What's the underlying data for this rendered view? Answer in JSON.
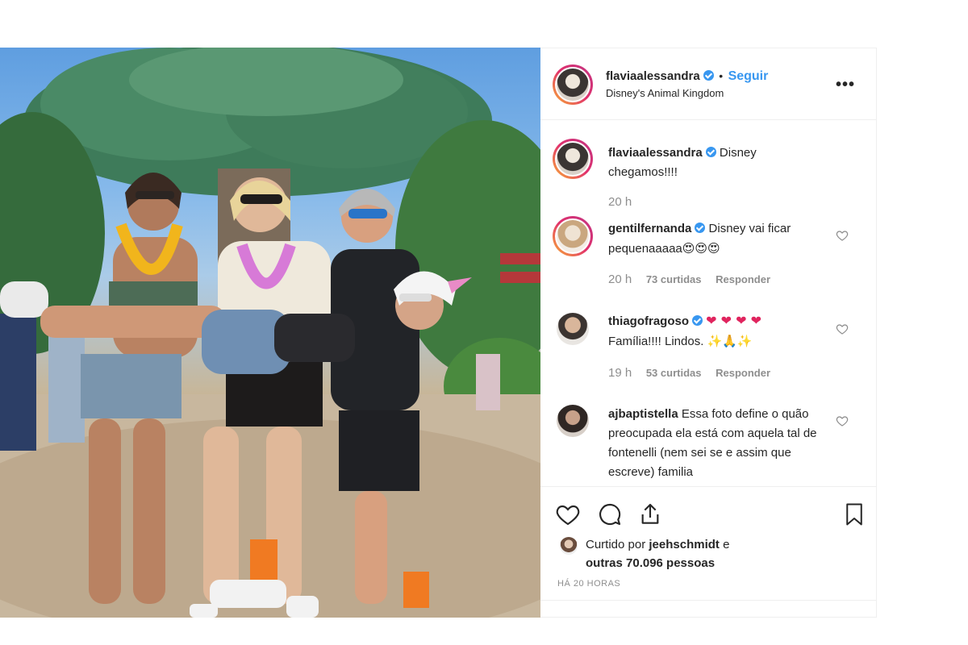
{
  "post": {
    "author": "flaviaalessandra",
    "separator": "•",
    "follow_label": "Seguir",
    "location": "Disney's Animal Kingdom",
    "more_icon": "more-icon"
  },
  "caption": {
    "username": "flaviaalessandra",
    "text": "Disney chegamos!!!!",
    "time": "20 h"
  },
  "comments": [
    {
      "username": "gentilfernanda",
      "verified": true,
      "text": "Disney vai ficar pequenaaaaa",
      "emoji": "😍😍😍",
      "time": "20 h",
      "likes": "73 curtidas",
      "reply": "Responder"
    },
    {
      "username": "thiagofragoso",
      "verified": true,
      "text_before": "",
      "hearts": "❤ ❤ ❤ ❤",
      "text": "Família!!!! Lindos.",
      "emoji": "✨🙏✨",
      "time": "19 h",
      "likes": "53 curtidas",
      "reply": "Responder"
    },
    {
      "username": "ajbaptistella",
      "verified": false,
      "text": "Essa foto define o quão preocupada ela está com aquela tal de fontenelli (nem sei se e assim que escreve) familia",
      "time": "",
      "likes": "",
      "reply": ""
    }
  ],
  "likes": {
    "prefix": "Curtido por",
    "user": "jeehschmidt",
    "middle": "e",
    "others": "outras 70.096 pessoas"
  },
  "time_ago": "HÁ 20 HORAS",
  "colors": {
    "accent": "#3897f0",
    "text": "#262626",
    "muted": "#8e8e8e",
    "border": "#efefef"
  }
}
